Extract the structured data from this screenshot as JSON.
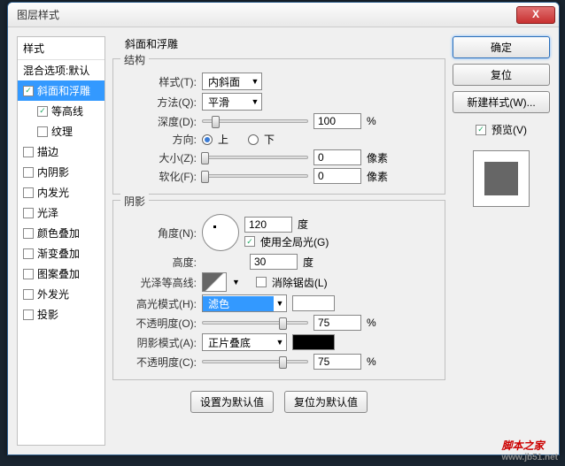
{
  "window": {
    "title": "图层样式",
    "close": "X"
  },
  "styles_panel": {
    "header": "样式",
    "items": [
      {
        "label": "混合选项:默认",
        "checkbox": false
      },
      {
        "label": "斜面和浮雕",
        "checkbox": true,
        "checked": true,
        "selected": true
      },
      {
        "label": "等高线",
        "checkbox": true,
        "checked": true,
        "indent": true
      },
      {
        "label": "纹理",
        "checkbox": true,
        "checked": false,
        "indent": true
      },
      {
        "label": "描边",
        "checkbox": true,
        "checked": false
      },
      {
        "label": "内阴影",
        "checkbox": true,
        "checked": false
      },
      {
        "label": "内发光",
        "checkbox": true,
        "checked": false
      },
      {
        "label": "光泽",
        "checkbox": true,
        "checked": false
      },
      {
        "label": "颜色叠加",
        "checkbox": true,
        "checked": false
      },
      {
        "label": "渐变叠加",
        "checkbox": true,
        "checked": false
      },
      {
        "label": "图案叠加",
        "checkbox": true,
        "checked": false
      },
      {
        "label": "外发光",
        "checkbox": true,
        "checked": false
      },
      {
        "label": "投影",
        "checkbox": true,
        "checked": false
      }
    ]
  },
  "section_title": "斜面和浮雕",
  "structure": {
    "legend": "结构",
    "style_lbl": "样式(T):",
    "style_val": "内斜面",
    "method_lbl": "方法(Q):",
    "method_val": "平滑",
    "depth_lbl": "深度(D):",
    "depth_val": "100",
    "depth_unit": "%",
    "dir_lbl": "方向:",
    "dir_up": "上",
    "dir_down": "下",
    "size_lbl": "大小(Z):",
    "size_val": "0",
    "size_unit": "像素",
    "soften_lbl": "软化(F):",
    "soften_val": "0",
    "soften_unit": "像素"
  },
  "shading": {
    "legend": "阴影",
    "angle_lbl": "角度(N):",
    "angle_val": "120",
    "angle_unit": "度",
    "global_light": "使用全局光(G)",
    "altitude_lbl": "高度:",
    "altitude_val": "30",
    "altitude_unit": "度",
    "gloss_lbl": "光泽等高线:",
    "antialias": "消除锯齿(L)",
    "hl_mode_lbl": "高光模式(H):",
    "hl_mode_val": "滤色",
    "hl_color": "#ffffff",
    "hl_op_lbl": "不透明度(O):",
    "hl_op_val": "75",
    "pct": "%",
    "sh_mode_lbl": "阴影模式(A):",
    "sh_mode_val": "正片叠底",
    "sh_color": "#000000",
    "sh_op_lbl": "不透明度(C):",
    "sh_op_val": "75"
  },
  "bottom": {
    "make_default": "设置为默认值",
    "reset_default": "复位为默认值"
  },
  "right": {
    "ok": "确定",
    "cancel": "复位",
    "new_style": "新建样式(W)...",
    "preview": "预览(V)"
  },
  "watermark": {
    "main": "脚本之家",
    "sub": "www.jb51.net"
  }
}
